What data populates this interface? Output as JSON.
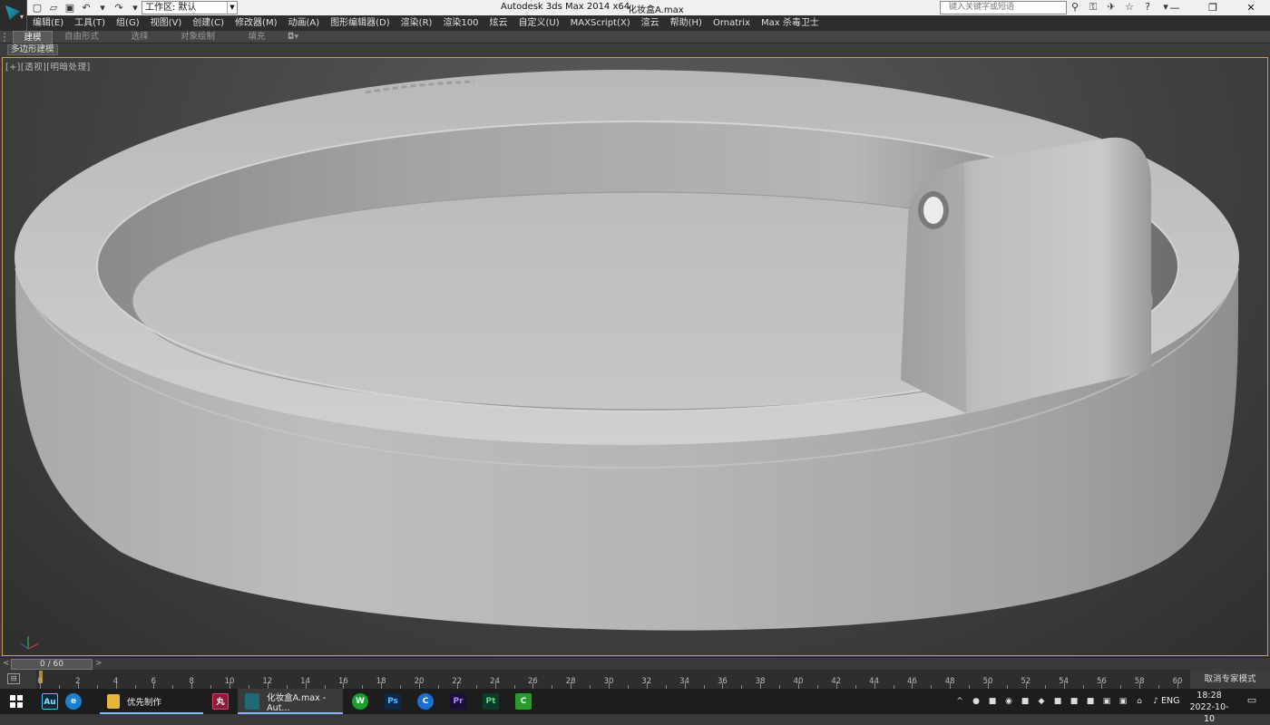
{
  "app": {
    "title": "Autodesk 3ds Max  2014 x64",
    "file": "化妆盒A.max",
    "workspace_label": "工作区: 默认",
    "search_placeholder": "键入关键字或短语"
  },
  "window_buttons": [
    "—",
    "❐",
    "✕"
  ],
  "menu": [
    "编辑(E)",
    "工具(T)",
    "组(G)",
    "视图(V)",
    "创建(C)",
    "修改器(M)",
    "动画(A)",
    "图形编辑器(D)",
    "渲染(R)",
    "渲染100",
    "炫云",
    "自定义(U)",
    "MAXScript(X)",
    "渲云",
    "帮助(H)",
    "Ornatrix",
    "Max 杀毒卫士"
  ],
  "ribbon": {
    "tabs": [
      "建模",
      "自由形式",
      "选择",
      "对象绘制",
      "填充"
    ],
    "active": "建模",
    "sub_label": "多边形建模"
  },
  "viewport": {
    "label_plus": "[+]",
    "label_view": "[透视]",
    "label_shading": "[明暗处理]",
    "model_colors": {
      "body": "#c3c3c3",
      "shadow": "#8f8f8f",
      "highlight": "#dadada"
    }
  },
  "timeline": {
    "frame_display": "0 / 60",
    "ticks": [
      "0",
      "2",
      "4",
      "6",
      "8",
      "10",
      "12",
      "14",
      "16",
      "18",
      "20",
      "22",
      "24",
      "26",
      "28",
      "30",
      "32",
      "34",
      "36",
      "38",
      "40",
      "42",
      "44",
      "46",
      "48",
      "50",
      "52",
      "54",
      "56",
      "58",
      "60"
    ],
    "expert_mode_button": "取消专家模式"
  },
  "taskbar": {
    "pinned": [
      {
        "name": "after-effects",
        "label": "Au",
        "color": "#0c2a3a"
      },
      {
        "name": "edge",
        "label": "e",
        "color": "#1b7fd1"
      },
      {
        "name": "folder-task",
        "label": "优先制作"
      },
      {
        "name": "app-red",
        "label": "丸",
        "color": "#8b1c3a"
      },
      {
        "name": "3dsmax-task",
        "label": "化妆盒A.max - Aut..."
      },
      {
        "name": "wechat",
        "label": "W",
        "color": "#19a02f"
      },
      {
        "name": "photoshop",
        "label": "Ps",
        "color": "#0b2a4a"
      },
      {
        "name": "cinema",
        "label": "C",
        "color": "#1a6fd1"
      },
      {
        "name": "premiere",
        "label": "Pr",
        "color": "#1a0f3a"
      },
      {
        "name": "painter",
        "label": "Pt",
        "color": "#0e3a2a"
      },
      {
        "name": "camtasia",
        "label": "C",
        "color": "#2a9a2a"
      }
    ],
    "lang": "ENG",
    "time": "18:28",
    "date": "2022-10-10"
  }
}
